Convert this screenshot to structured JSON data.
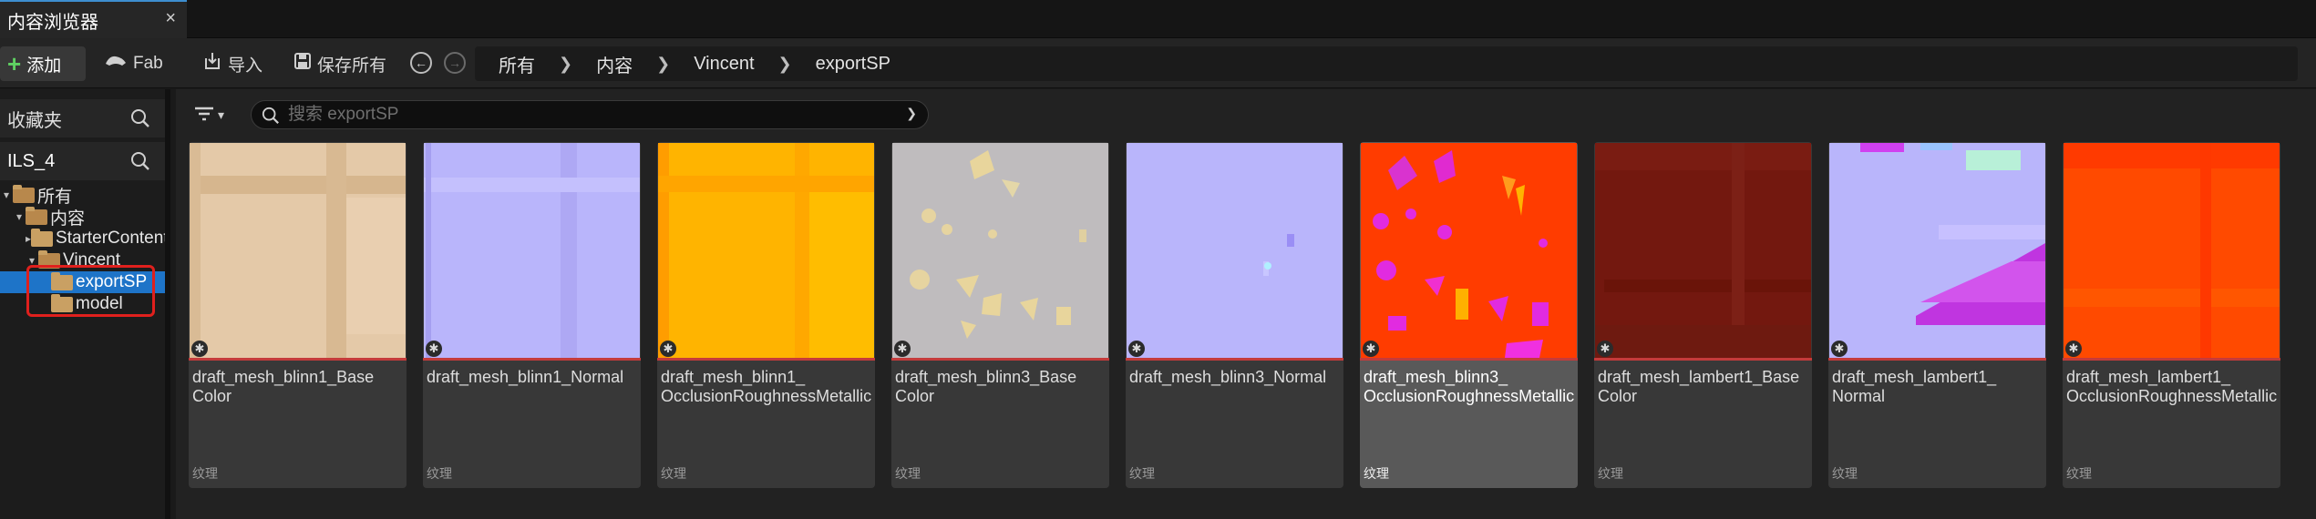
{
  "tab": {
    "title": "内容浏览器",
    "close": "×"
  },
  "toolbar": {
    "add_label": "添加",
    "fab_label": "Fab",
    "import_label": "导入",
    "save_all_label": "保存所有"
  },
  "breadcrumb": [
    "所有",
    "内容",
    "Vincent",
    "exportSP"
  ],
  "sidebar": {
    "favorites_label": "收藏夹",
    "project_label": "ILS_4",
    "tree": [
      {
        "label": "所有",
        "level": 0,
        "expanded": true,
        "selected": false
      },
      {
        "label": "内容",
        "level": 1,
        "expanded": true,
        "selected": false
      },
      {
        "label": "StarterContent",
        "level": 2,
        "expanded": false,
        "selected": false
      },
      {
        "label": "Vincent",
        "level": 2,
        "expanded": true,
        "selected": false
      },
      {
        "label": "exportSP",
        "level": 3,
        "expanded": false,
        "selected": true
      },
      {
        "label": "model",
        "level": 3,
        "expanded": false,
        "selected": false
      }
    ]
  },
  "search": {
    "placeholder": "搜索 exportSP"
  },
  "assets": [
    {
      "name": "draft_mesh_blinn1_Base\nColor",
      "type": "纹理",
      "selected": false,
      "thumb": "base1"
    },
    {
      "name": "draft_mesh_blinn1_Normal",
      "type": "纹理",
      "selected": false,
      "thumb": "normal1"
    },
    {
      "name": "draft_mesh_blinn1_\nOcclusionRoughnessMetallic",
      "type": "纹理",
      "selected": false,
      "thumb": "orm1"
    },
    {
      "name": "draft_mesh_blinn3_Base\nColor",
      "type": "纹理",
      "selected": false,
      "thumb": "base3"
    },
    {
      "name": "draft_mesh_blinn3_Normal",
      "type": "纹理",
      "selected": false,
      "thumb": "normal3"
    },
    {
      "name": "draft_mesh_blinn3_\nOcclusionRoughnessMetallic",
      "type": "纹理",
      "selected": true,
      "thumb": "orm3"
    },
    {
      "name": "draft_mesh_lambert1_Base\nColor",
      "type": "纹理",
      "selected": false,
      "thumb": "baseL"
    },
    {
      "name": "draft_mesh_lambert1_\nNormal",
      "type": "纹理",
      "selected": false,
      "thumb": "normalL"
    },
    {
      "name": "draft_mesh_lambert1_\nOcclusionRoughnessMetallic",
      "type": "纹理",
      "selected": false,
      "thumb": "ormL"
    }
  ],
  "colors": {
    "accent": "#1e74c8",
    "highlight_box": "#e0201d",
    "add_plus": "#5fd162"
  },
  "icons": [
    "plus-icon",
    "fab-icon",
    "import-icon",
    "save-icon",
    "back-arrow-icon",
    "forward-arrow-icon",
    "search-icon",
    "filter-icon",
    "folder-icon",
    "asset-star-icon"
  ]
}
